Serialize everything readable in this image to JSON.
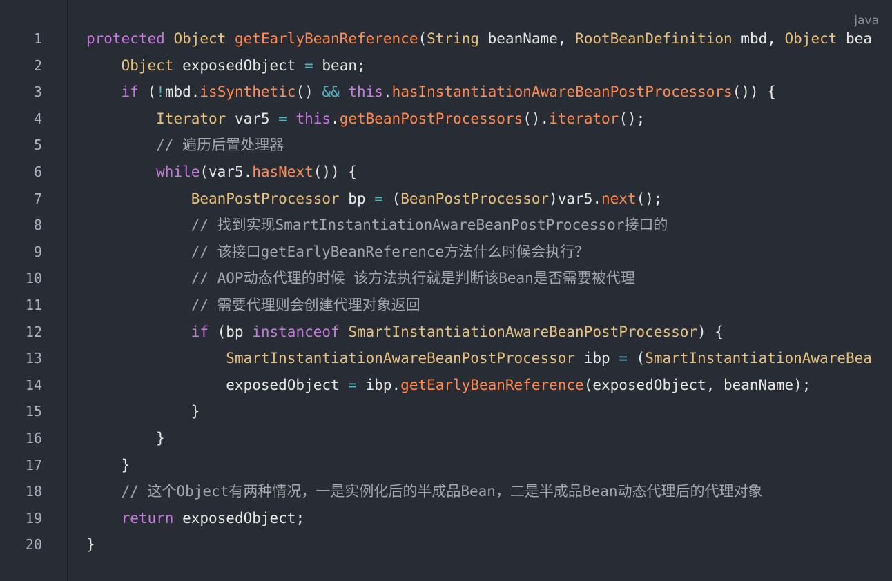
{
  "language_label": "java",
  "line_numbers": [
    "1",
    "2",
    "3",
    "4",
    "5",
    "6",
    "7",
    "8",
    "9",
    "10",
    "11",
    "12",
    "13",
    "14",
    "15",
    "16",
    "17",
    "18",
    "19",
    "20"
  ],
  "lines": [
    [
      {
        "t": "kw",
        "v": "protected "
      },
      {
        "t": "type",
        "v": "Object "
      },
      {
        "t": "fn",
        "v": "getEarlyBeanReference"
      },
      {
        "t": "var",
        "v": "("
      },
      {
        "t": "type",
        "v": "String "
      },
      {
        "t": "var",
        "v": "beanName, "
      },
      {
        "t": "type",
        "v": "RootBeanDefinition "
      },
      {
        "t": "var",
        "v": "mbd, "
      },
      {
        "t": "type",
        "v": "Object "
      },
      {
        "t": "var",
        "v": "bea"
      }
    ],
    [
      {
        "t": "var",
        "v": "    "
      },
      {
        "t": "type",
        "v": "Object "
      },
      {
        "t": "var",
        "v": "exposedObject "
      },
      {
        "t": "op",
        "v": "= "
      },
      {
        "t": "var",
        "v": "bean;"
      }
    ],
    [
      {
        "t": "var",
        "v": "    "
      },
      {
        "t": "kw",
        "v": "if "
      },
      {
        "t": "var",
        "v": "("
      },
      {
        "t": "op",
        "v": "!"
      },
      {
        "t": "var",
        "v": "mbd."
      },
      {
        "t": "fn",
        "v": "isSynthetic"
      },
      {
        "t": "var",
        "v": "() "
      },
      {
        "t": "op",
        "v": "&& "
      },
      {
        "t": "kw",
        "v": "this"
      },
      {
        "t": "var",
        "v": "."
      },
      {
        "t": "fn",
        "v": "hasInstantiationAwareBeanPostProcessors"
      },
      {
        "t": "var",
        "v": "()) {"
      }
    ],
    [
      {
        "t": "var",
        "v": "        "
      },
      {
        "t": "type",
        "v": "Iterator "
      },
      {
        "t": "var",
        "v": "var5 "
      },
      {
        "t": "op",
        "v": "= "
      },
      {
        "t": "kw",
        "v": "this"
      },
      {
        "t": "var",
        "v": "."
      },
      {
        "t": "fn",
        "v": "getBeanPostProcessors"
      },
      {
        "t": "var",
        "v": "()."
      },
      {
        "t": "fn",
        "v": "iterator"
      },
      {
        "t": "var",
        "v": "();"
      }
    ],
    [
      {
        "t": "var",
        "v": "        "
      },
      {
        "t": "cm",
        "v": "// 遍历后置处理器"
      }
    ],
    [
      {
        "t": "var",
        "v": "        "
      },
      {
        "t": "kw",
        "v": "while"
      },
      {
        "t": "var",
        "v": "(var5."
      },
      {
        "t": "fn",
        "v": "hasNext"
      },
      {
        "t": "var",
        "v": "()) {"
      }
    ],
    [
      {
        "t": "var",
        "v": "            "
      },
      {
        "t": "type",
        "v": "BeanPostProcessor "
      },
      {
        "t": "var",
        "v": "bp "
      },
      {
        "t": "op",
        "v": "= "
      },
      {
        "t": "var",
        "v": "("
      },
      {
        "t": "type",
        "v": "BeanPostProcessor"
      },
      {
        "t": "var",
        "v": ")var5."
      },
      {
        "t": "fn",
        "v": "next"
      },
      {
        "t": "var",
        "v": "();"
      }
    ],
    [
      {
        "t": "var",
        "v": "            "
      },
      {
        "t": "cm",
        "v": "// 找到实现SmartInstantiationAwareBeanPostProcessor接口的"
      }
    ],
    [
      {
        "t": "var",
        "v": "            "
      },
      {
        "t": "cm",
        "v": "// 该接口getEarlyBeanReference方法什么时候会执行？"
      }
    ],
    [
      {
        "t": "var",
        "v": "            "
      },
      {
        "t": "cm",
        "v": "// AOP动态代理的时候 该方法执行就是判断该Bean是否需要被代理"
      }
    ],
    [
      {
        "t": "var",
        "v": "            "
      },
      {
        "t": "cm",
        "v": "// 需要代理则会创建代理对象返回"
      }
    ],
    [
      {
        "t": "var",
        "v": "            "
      },
      {
        "t": "kw",
        "v": "if "
      },
      {
        "t": "var",
        "v": "(bp "
      },
      {
        "t": "kw",
        "v": "instanceof "
      },
      {
        "t": "type",
        "v": "SmartInstantiationAwareBeanPostProcessor"
      },
      {
        "t": "var",
        "v": ") {"
      }
    ],
    [
      {
        "t": "var",
        "v": "                "
      },
      {
        "t": "type",
        "v": "SmartInstantiationAwareBeanPostProcessor "
      },
      {
        "t": "var",
        "v": "ibp "
      },
      {
        "t": "op",
        "v": "= "
      },
      {
        "t": "var",
        "v": "("
      },
      {
        "t": "type",
        "v": "SmartInstantiationAwareBea"
      }
    ],
    [
      {
        "t": "var",
        "v": "                exposedObject "
      },
      {
        "t": "op",
        "v": "= "
      },
      {
        "t": "var",
        "v": "ibp."
      },
      {
        "t": "fn",
        "v": "getEarlyBeanReference"
      },
      {
        "t": "var",
        "v": "(exposedObject, beanName);"
      }
    ],
    [
      {
        "t": "var",
        "v": "            }"
      }
    ],
    [
      {
        "t": "var",
        "v": "        }"
      }
    ],
    [
      {
        "t": "var",
        "v": "    }"
      }
    ],
    [
      {
        "t": "var",
        "v": "    "
      },
      {
        "t": "cm",
        "v": "// 这个Object有两种情况，一是实例化后的半成品Bean，二是半成品Bean动态代理后的代理对象"
      }
    ],
    [
      {
        "t": "var",
        "v": "    "
      },
      {
        "t": "kw",
        "v": "return "
      },
      {
        "t": "var",
        "v": "exposedObject;"
      }
    ],
    [
      {
        "t": "var",
        "v": "}"
      }
    ]
  ]
}
